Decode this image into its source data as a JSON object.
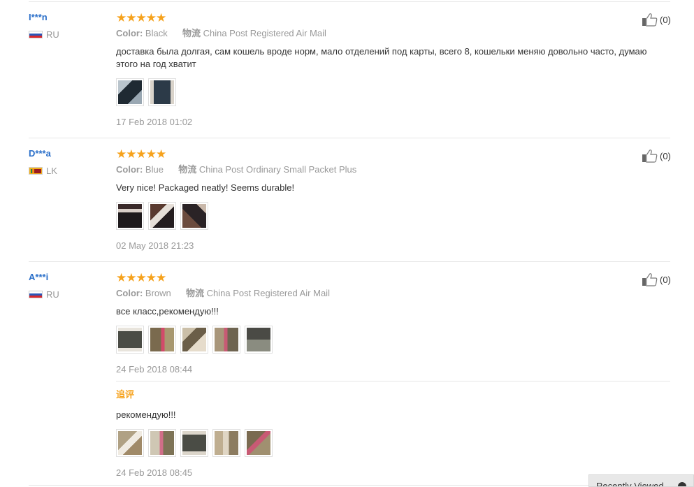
{
  "reviews": [
    {
      "user": "I***n",
      "country": "RU",
      "flag_icon": "russia-flag-icon",
      "rating": 5,
      "stars": "★★★★★",
      "color_key": "Color:",
      "color_value": "Black",
      "shipping_key": "物流",
      "shipping_value": "China Post Registered Air Mail",
      "text": "доставка была долгая, сам кошель вроде норм, мало отделений под карты, всего 8, кошельки меняю довольно часто, думаю этого на год хватит",
      "photo_count": 2,
      "date": "17 Feb 2018 01:02",
      "helpful_count": "(0)"
    },
    {
      "user": "D***a",
      "country": "LK",
      "flag_icon": "sri-lanka-flag-icon",
      "rating": 5,
      "stars": "★★★★★",
      "color_key": "Color:",
      "color_value": "Blue",
      "shipping_key": "物流",
      "shipping_value": "China Post Ordinary Small Packet Plus",
      "text": "Very nice! Packaged neatly! Seems durable!",
      "photo_count": 3,
      "date": "02 May 2018 21:23",
      "helpful_count": "(0)"
    },
    {
      "user": "A***i",
      "country": "RU",
      "flag_icon": "russia-flag-icon",
      "rating": 5,
      "stars": "★★★★★",
      "color_key": "Color:",
      "color_value": "Brown",
      "shipping_key": "物流",
      "shipping_value": "China Post Registered Air Mail",
      "text": "все класс,рекомендую!!!",
      "photo_count": 5,
      "date": "24 Feb 2018 08:44",
      "helpful_count": "(0)",
      "followup": {
        "label": "追评",
        "text": "рекомендую!!!",
        "photo_count": 5,
        "date": "24 Feb 2018 08:45"
      }
    }
  ],
  "recently_viewed": {
    "label": "Recently Viewed"
  },
  "colors": {
    "username": "#2a6fc9",
    "stars": "#f6a21c",
    "followup_label": "#f6a21c",
    "muted": "#999999"
  }
}
